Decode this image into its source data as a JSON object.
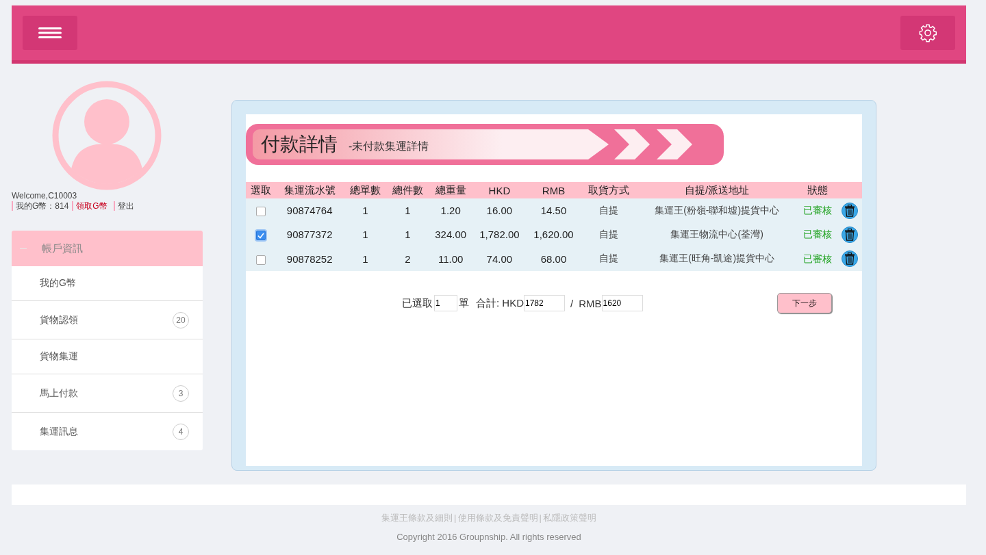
{
  "user": {
    "welcome": "Welcome,C10003",
    "coins_label": "我的G幣：814",
    "claim_link": "領取G幣",
    "logout_link": "登出"
  },
  "sidebar": {
    "header": {
      "label": "帳戶資訊",
      "expanded": true
    },
    "items": [
      {
        "label": "我的G幣"
      },
      {
        "label": "貨物認領",
        "badge": "20"
      },
      {
        "label": "貨物集運"
      },
      {
        "label": "馬上付款",
        "badge": "3"
      },
      {
        "label": "集運訊息",
        "badge": "4"
      }
    ]
  },
  "banner": {
    "title": "付款詳情",
    "subtitle": "-未付款集運詳情"
  },
  "table": {
    "columns": [
      "選取",
      "集運流水號",
      "總單數",
      "總件數",
      "總重量",
      "HKD",
      "RMB",
      "取貨方式",
      "自提/派送地址",
      "狀態"
    ],
    "rows": [
      {
        "checked": false,
        "cells": [
          "",
          "90874764",
          "1",
          "1",
          "1.20",
          "16.00",
          "14.50",
          "自提",
          "集運王(粉嶺-聯和墟)提貨中心"
        ],
        "status": "已審核",
        "color": "#22a322"
      },
      {
        "checked": true,
        "cells": [
          "",
          "90877372",
          "1",
          "1",
          "324.00",
          "1,782.00",
          "1,620.00",
          "自提",
          "集運王物流中心(荃灣)"
        ],
        "status": "已審核",
        "color": "#22a322"
      },
      {
        "checked": false,
        "cells": [
          "",
          "90878252",
          "1",
          "2",
          "11.00",
          "74.00",
          "68.00",
          "自提",
          "集運王(旺角-凱途)提貨中心"
        ],
        "status": "已審核",
        "color": "#22a322"
      }
    ]
  },
  "summary": {
    "selected_label": "已選取",
    "selected_value": "1",
    "unit": "單",
    "total_label": "合計: HKD",
    "hkd_value": "1782",
    "slash": "/",
    "rmb_label": "RMB",
    "rmb_value": "1620",
    "next_button": "下一步"
  },
  "footer": {
    "links": [
      "集運王條款及細則",
      "使用條款及免責聲明",
      "私隱政策聲明"
    ],
    "separators": [
      "|",
      "|"
    ],
    "copyright": "Copyright 2016 Groupnship. All rights reserved"
  }
}
